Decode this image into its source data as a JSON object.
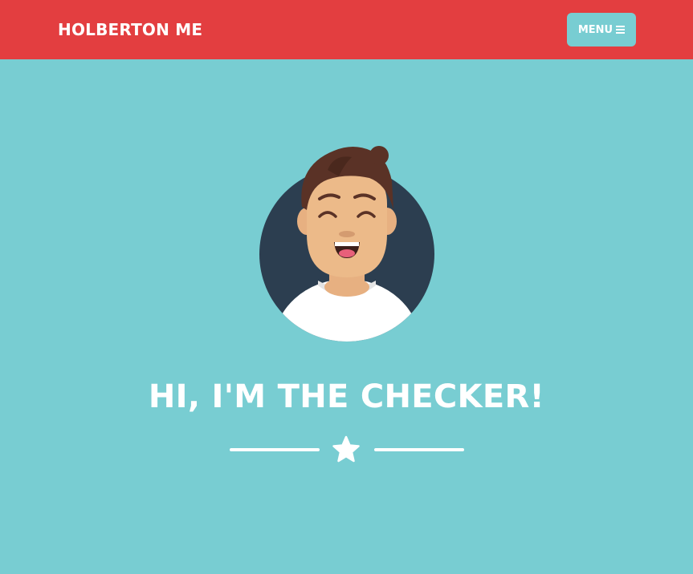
{
  "navbar": {
    "brand": "HOLBERTON ME",
    "menu_label": "MENU",
    "menu_icon": "hamburger-icon"
  },
  "masthead": {
    "avatar_icon": "avatar-icon",
    "title": "HI, I'M THE CHECKER!",
    "divider_icon": "star-icon"
  },
  "colors": {
    "navbar_bg": "#e33e40",
    "page_bg": "#78cdd2",
    "text": "#ffffff",
    "avatar_circle": "#2c3e50"
  }
}
